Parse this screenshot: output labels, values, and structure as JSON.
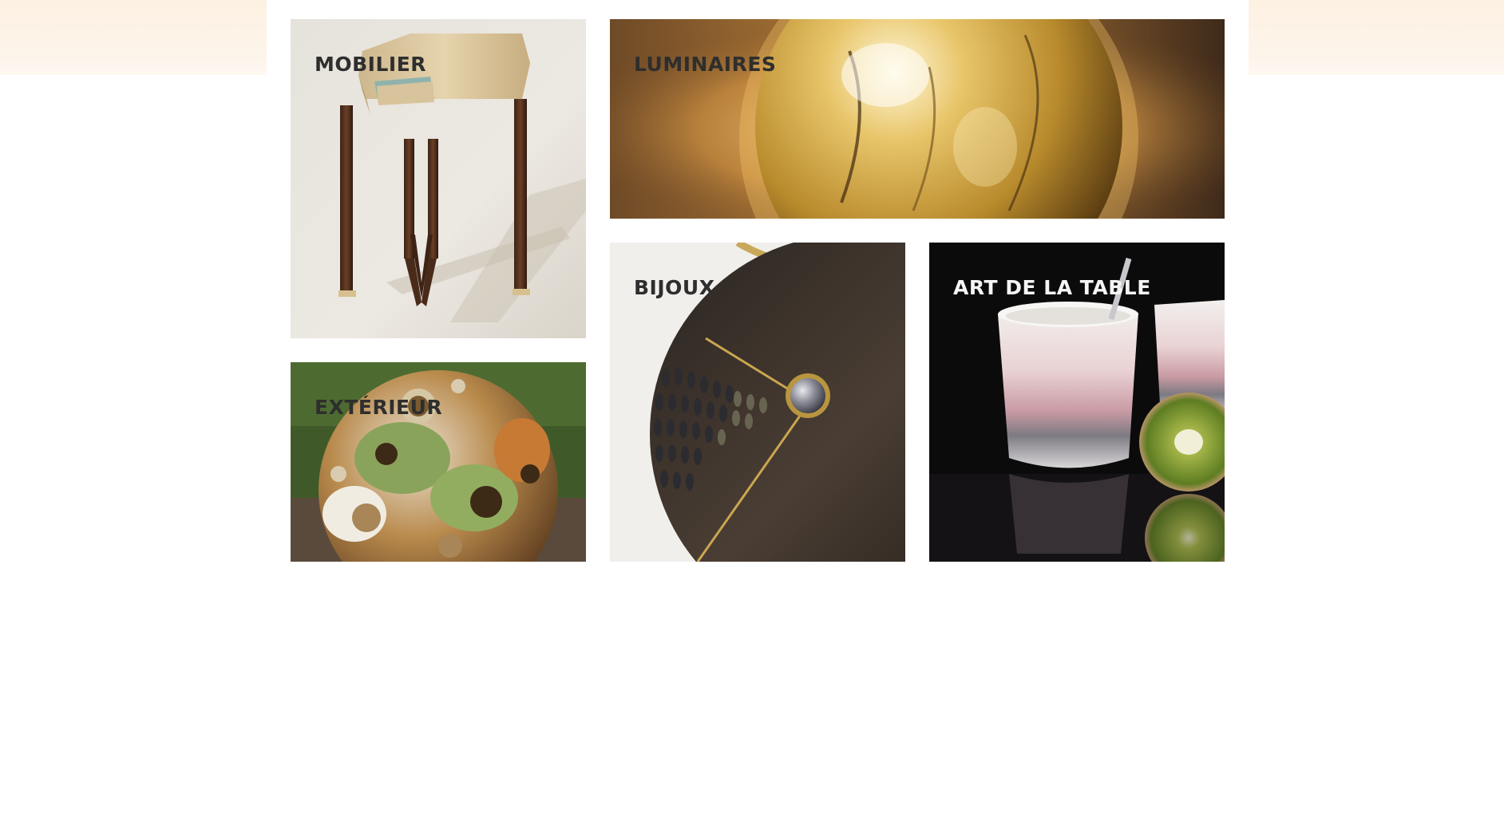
{
  "categories": [
    {
      "key": "mobilier",
      "label": "MOBILIER",
      "image": "side-table-photo"
    },
    {
      "key": "luminaires",
      "label": "LUMINAIRES",
      "image": "golden-sphere-lamp-photo"
    },
    {
      "key": "exterieur",
      "label": "EXTÉRIEUR",
      "image": "perforated-ceramic-sphere-photo"
    },
    {
      "key": "bijoux",
      "label": "BIJOUX",
      "image": "ebony-pendant-necklace-photo"
    },
    {
      "key": "art_de_la_table",
      "label": "ART DE LA TABLE",
      "image": "porcelain-cups-kiwi-photo"
    }
  ],
  "colors": {
    "header_band": "#fdf2e4",
    "label_dark": "#2e2e2e",
    "label_light": "#f5f5f5",
    "page_background": "#ffffff"
  }
}
